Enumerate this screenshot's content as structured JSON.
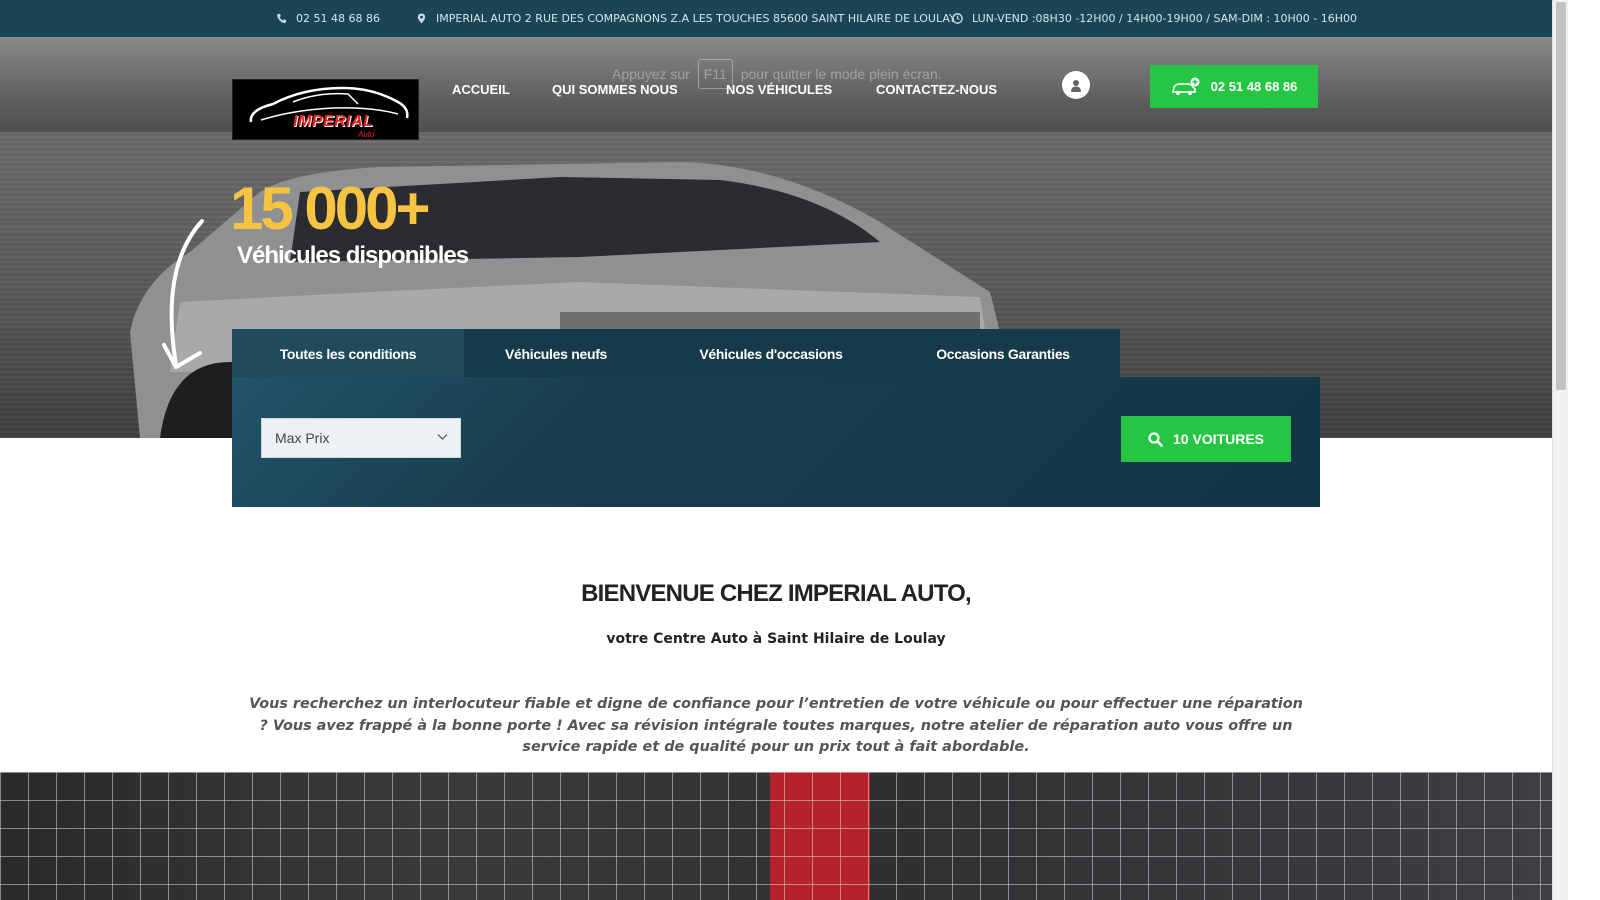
{
  "topbar": {
    "phone": "02 51 48 68 86",
    "address": "IMPERIAL AUTO 2 RUE DES COMPAGNONS Z.A LES TOUCHES 85600 SAINT HILAIRE DE LOULAY",
    "hours": "LUN-VEND :08H30 -12H00 / 14H00-19H00 / SAM-DIM : 10H00 - 16H00"
  },
  "fullscreen_hint": {
    "before": "Appuyez sur",
    "key": "F11",
    "after": "pour quitter le mode plein écran."
  },
  "logo": {
    "text": "IMPERIAL",
    "sub": "Auto"
  },
  "nav": {
    "items": [
      "ACCUEIL",
      "QUI SOMMES NOUS",
      "NOS VÉHICULES",
      "CONTACTEZ-NOUS"
    ]
  },
  "header_phone": "02 51 48 68 86",
  "hero": {
    "count": "15 000+",
    "subtitle": "Véhicules disponibles"
  },
  "search": {
    "tabs": [
      "Toutes les conditions",
      "Véhicules neufs",
      "Véhicules d'occasions",
      "Occasions Garanties"
    ],
    "active_tab": "Toutes les conditions",
    "max_price_label": "Max Prix",
    "button_label": "10 VOITURES"
  },
  "welcome": {
    "title": "BIENVENUE CHEZ IMPERIAL AUTO,",
    "subtitle": "votre Centre Auto à Saint Hilaire de Loulay",
    "text": "Vous recherchez un interlocuteur fiable et digne de confiance pour l’entretien de votre véhicule ou pour effectuer une réparation ? Vous avez frappé à la bonne porte ! Avec sa révision intégrale toutes marques, notre atelier de réparation auto vous offre un service rapide et de qualité pour un prix tout à fait abordable."
  },
  "colors": {
    "topbar": "#1a4556",
    "accent_green": "#26c644",
    "accent_yellow": "#f6c343",
    "panel": "#163a49"
  }
}
